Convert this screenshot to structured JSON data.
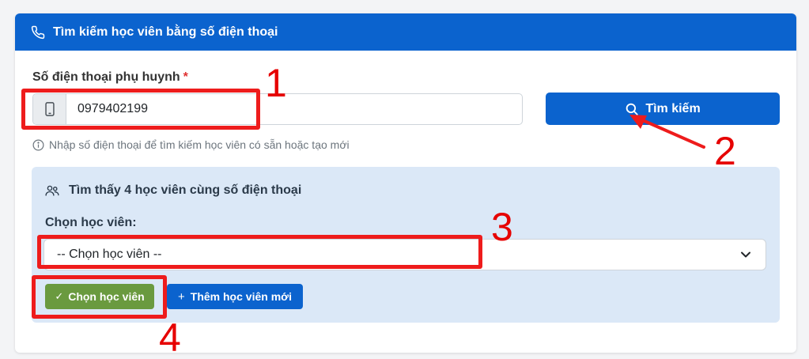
{
  "header": {
    "title": "Tìm kiếm học viên bằng số điện thoại",
    "icon": "phone-icon"
  },
  "phone": {
    "label": "Số điện thoại phụ huynh",
    "required_mark": "*",
    "value": "0979402199",
    "prefix_icon": "mobile-icon"
  },
  "search_button": {
    "label": "Tìm kiếm",
    "icon": "search-icon"
  },
  "help_text": "Nhập số điện thoại để tìm kiếm học viên có sẵn hoặc tạo mới",
  "found": {
    "title": "Tìm thấy 4 học viên cùng số điện thoại",
    "icon": "users-icon",
    "choose_label": "Chọn học viên:",
    "select_value": "-- Chọn học viên --"
  },
  "actions": {
    "choose_label": "Chọn học viên",
    "add_label": "Thêm học viên mới"
  },
  "annotations": [
    "1",
    "2",
    "3",
    "4"
  ],
  "colors": {
    "primary": "#0b63ce",
    "success": "#6a9a3f",
    "panel": "#dbe8f7",
    "annotation": "#ee1c1c"
  }
}
